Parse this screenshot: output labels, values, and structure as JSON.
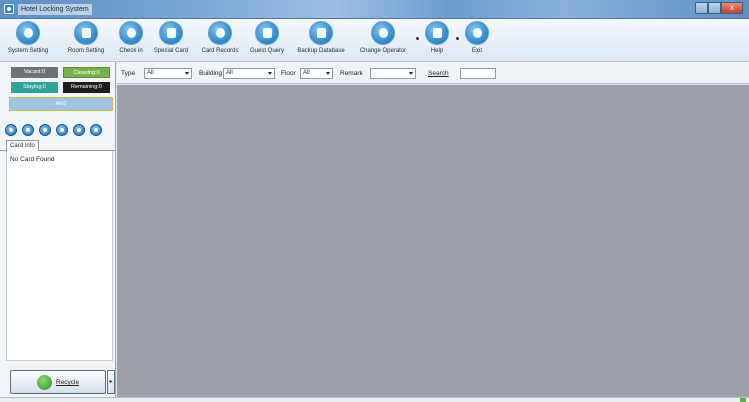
{
  "window": {
    "title": "Hotel Locking System",
    "close_glyph": "x"
  },
  "toolbar": {
    "buttons": [
      {
        "label": "System Setting",
        "icon": "gear-icon"
      },
      {
        "label": "Room Setting",
        "icon": "room-icon"
      },
      {
        "label": "Check in",
        "icon": "check-in-icon"
      },
      {
        "label": "Special Card",
        "icon": "special-card-icon"
      },
      {
        "label": "Card Records",
        "icon": "card-records-icon"
      },
      {
        "label": "Guest Query",
        "icon": "guest-query-icon"
      },
      {
        "label": "Backup Database",
        "icon": "backup-database-icon"
      },
      {
        "label": "Change Operator",
        "icon": "change-operator-icon"
      },
      {
        "label": "Help",
        "icon": "help-icon"
      },
      {
        "label": "Exit",
        "icon": "exit-icon"
      }
    ]
  },
  "status_counts": {
    "vacant": "Vacant:0",
    "cleaning": "Cleaning:0",
    "staying": "Staying:0",
    "remaining": "Remaining:0",
    "all": "All:0"
  },
  "status_colors": {
    "vacant": "#6c7275",
    "cleaning": "#78b04c",
    "staying": "#2fa39a",
    "remaining": "#1d1d1d"
  },
  "left_panel": {
    "tab_label": "Card Info",
    "empty_message": "No Card Found",
    "recycle_label": "Recycle",
    "dropdown_glyph": "▸"
  },
  "filters": {
    "type_label": "Type",
    "type_value": "All",
    "building_label": "Building",
    "building_value": "All",
    "floor_label": "Floor",
    "floor_value": "All",
    "remark_label": "Remark",
    "remark_value": "",
    "search_label": "Search",
    "search_value": ""
  }
}
